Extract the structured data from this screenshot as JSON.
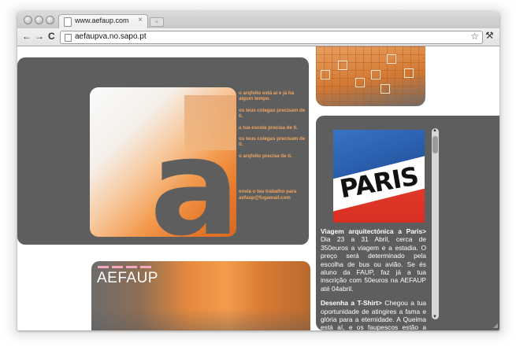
{
  "browser": {
    "tab_title": "www.aefaup.com",
    "tab_close": "×",
    "new_tab": "+",
    "url": "aefaupva.no.sapo.pt",
    "back": "←",
    "forward": "→",
    "reload": "C",
    "star": "☆",
    "wrench": "🔧"
  },
  "intro": {
    "messages": [
      "o arqfolio está aí e já há algum tempo.",
      "os teus colegas precisam de ti.",
      "a tua escola precisa de ti.",
      "os teus colegas precisam de ti.",
      "o arqfolio precisa de ti.",
      "envia o teu trabalho para aefaup@fugamail.com"
    ],
    "big_letter": "a"
  },
  "poster": {
    "title": "PARIS"
  },
  "article": {
    "trip_title": "Viagem arquitectónica a Paris>",
    "trip_body": "Dia 23 a 31 Abril, cerca de 350euros a viagem e a estadia. O preço será determinado pela escolha de bus ou avião. Se és aluno da FAUP, faz já a tua inscrição com 50euros na AEFAUP até 04abril.",
    "tshirt_title": "Desenha a T-Shirt>",
    "tshirt_body": "Chegou a tua oportunidade de atingires a fama e glória para a eternidade. A Queima está aí, e os faupescos estão a precisar de ..."
  },
  "banner": {
    "logo": "AEFAUP"
  },
  "colors": {
    "panel": "#5e5e5e",
    "accent_orange": "#f0a460",
    "page_bg": "#ffffff"
  }
}
